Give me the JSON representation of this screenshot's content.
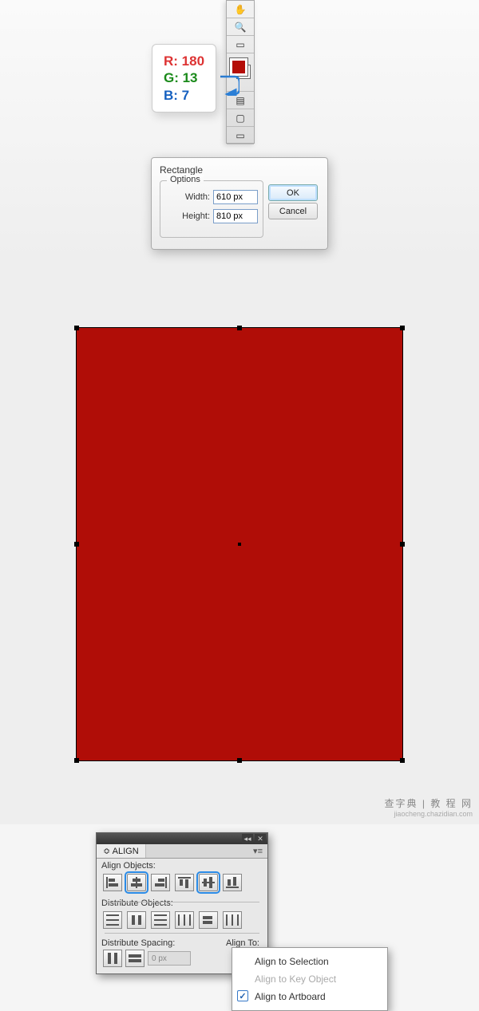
{
  "rgb_tooltip": {
    "r_label": "R: 180",
    "g_label": "G: 13",
    "b_label": "B: 7",
    "r_color": "#d33",
    "g_color": "#1a8a1a",
    "b_color": "#1560c0"
  },
  "tools": {
    "hand": "✋",
    "zoom": "🔍",
    "slice": "▭",
    "swap": "⇄",
    "gradient": "▤",
    "screen": "▢",
    "doc": "▭"
  },
  "rectangle_dialog": {
    "title": "Rectangle",
    "options_label": "Options",
    "width_label": "Width:",
    "width_value": "610 px",
    "height_label": "Height:",
    "height_value": "810 px",
    "ok": "OK",
    "cancel": "Cancel"
  },
  "align_panel": {
    "tab": "≎ ALIGN",
    "align_objects_label": "Align Objects:",
    "distribute_objects_label": "Distribute Objects:",
    "distribute_spacing_label": "Distribute Spacing:",
    "align_to_label": "Align To:",
    "spacing_value": "0 px"
  },
  "align_dropdown": {
    "opt1": "Align to Selection",
    "opt2": "Align to Key Object",
    "opt3": "Align to Artboard",
    "check": "✓"
  },
  "watermark": {
    "line1": "查字典 | 教 程 网",
    "line2": "jiaocheng.chazidian.com"
  }
}
